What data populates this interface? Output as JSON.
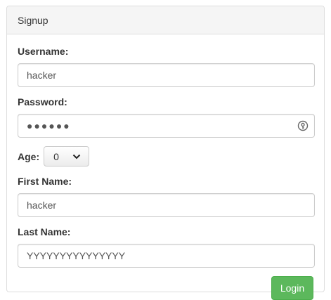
{
  "panel": {
    "title": "Signup"
  },
  "form": {
    "username_label": "Username:",
    "username_value": "hacker",
    "password_label": "Password:",
    "password_value": "●●●●●●",
    "age_label": "Age:",
    "age_selected": "0",
    "first_name_label": "First Name:",
    "first_name_value": "hacker",
    "last_name_label": "Last Name:",
    "last_name_value": "YYYYYYYYYYYYYYY",
    "submit_label": "Login"
  },
  "icons": {
    "password_manager": "key-icon",
    "select_arrow": "chevron-down-icon"
  },
  "colors": {
    "button_bg": "#5cb85c",
    "button_border": "#4cae4c",
    "heading_bg": "#f5f5f5",
    "border": "#dddddd"
  }
}
